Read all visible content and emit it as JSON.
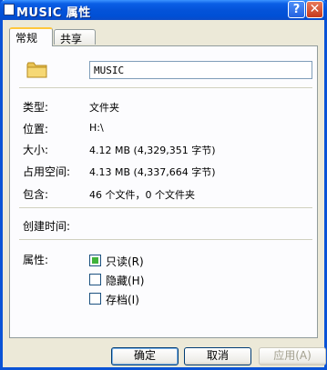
{
  "window": {
    "title": "MUSIC 属性",
    "help_glyph": "?",
    "close_glyph": "✕"
  },
  "tabs": [
    {
      "label": "常规",
      "active": true
    },
    {
      "label": "共享",
      "active": false
    }
  ],
  "general": {
    "folder_name": "MUSIC",
    "type_label": "类型:",
    "type_value": "文件夹",
    "location_label": "位置:",
    "location_value": "H:\\",
    "size_label": "大小:",
    "size_value": "4.12 MB (4,329,351 字节)",
    "disk_size_label": "占用空间:",
    "disk_size_value": "4.13 MB (4,337,664 字节)",
    "contains_label": "包含:",
    "contains_value": "46 个文件，0 个文件夹",
    "created_label": "创建时间:",
    "attributes_label": "属性:",
    "attributes": [
      {
        "label": "只读(R)",
        "checked": true
      },
      {
        "label": "隐藏(H)",
        "checked": false
      },
      {
        "label": "存档(I)",
        "checked": false
      }
    ]
  },
  "buttons": {
    "ok": "确定",
    "cancel": "取消",
    "apply": "应用(A)"
  },
  "colors": {
    "titlebar": "#0453D9",
    "face": "#ECE9D8",
    "tab_highlight": "#FFC73C"
  }
}
